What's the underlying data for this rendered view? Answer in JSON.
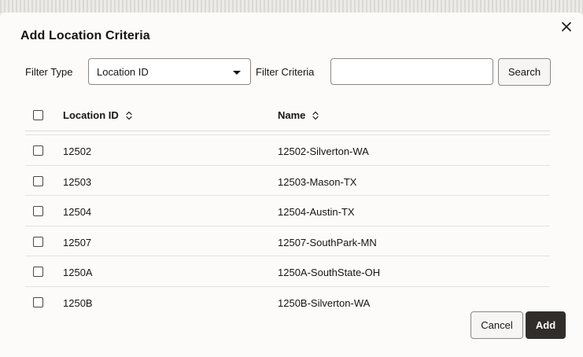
{
  "dialog": {
    "title": "Add Location Criteria",
    "close_icon": "close-icon"
  },
  "filter": {
    "type_label": "Filter Type",
    "type_selected": "Location ID",
    "criteria_label": "Filter Criteria",
    "criteria_value": "",
    "criteria_placeholder": "",
    "search_label": "Search"
  },
  "table": {
    "columns": [
      {
        "label": "Location ID",
        "sort_icon": "sort-icon"
      },
      {
        "label": "Name",
        "sort_icon": "sort-icon"
      }
    ],
    "rows": [
      {
        "id": "12502",
        "name": "12502-Silverton-WA"
      },
      {
        "id": "12503",
        "name": "12503-Mason-TX"
      },
      {
        "id": "12504",
        "name": "12504-Austin-TX"
      },
      {
        "id": "12507",
        "name": "12507-SouthPark-MN"
      },
      {
        "id": "1250A",
        "name": "1250A-SouthState-OH"
      },
      {
        "id": "1250B",
        "name": "1250B-Silverton-WA"
      }
    ]
  },
  "footer": {
    "cancel_label": "Cancel",
    "add_label": "Add"
  },
  "colors": {
    "primary_button": "#312d2a",
    "border": "#8a8783",
    "dialog_bg": "#fcfbfa"
  }
}
